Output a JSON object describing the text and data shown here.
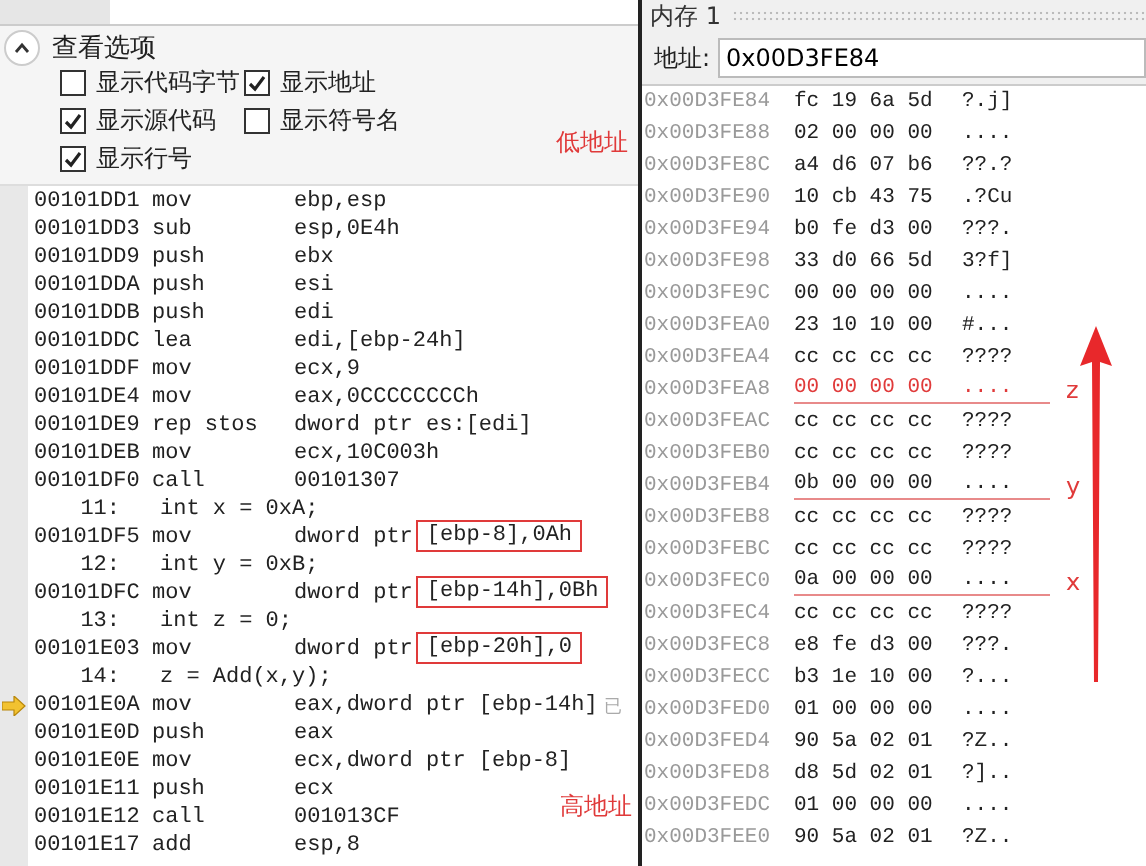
{
  "options": {
    "title": "查看选项",
    "expanded": true,
    "items": [
      {
        "label": "显示代码字节",
        "checked": false
      },
      {
        "label": "显示地址",
        "checked": true
      },
      {
        "label": "显示源代码",
        "checked": true
      },
      {
        "label": "显示符号名",
        "checked": false
      },
      {
        "label": "显示行号",
        "checked": true
      }
    ]
  },
  "disassembly": {
    "hint": "已",
    "lines": [
      {
        "kind": "asm",
        "address": "00101DD1",
        "mnemonic": "mov",
        "operands": "ebp,esp",
        "current": false
      },
      {
        "kind": "asm",
        "address": "00101DD3",
        "mnemonic": "sub",
        "operands": "esp,0E4h",
        "current": false
      },
      {
        "kind": "asm",
        "address": "00101DD9",
        "mnemonic": "push",
        "operands": "ebx",
        "current": false
      },
      {
        "kind": "asm",
        "address": "00101DDA",
        "mnemonic": "push",
        "operands": "esi",
        "current": false
      },
      {
        "kind": "asm",
        "address": "00101DDB",
        "mnemonic": "push",
        "operands": "edi",
        "current": false
      },
      {
        "kind": "asm",
        "address": "00101DDC",
        "mnemonic": "lea",
        "operands": "edi,[ebp-24h]",
        "current": false
      },
      {
        "kind": "asm",
        "address": "00101DDF",
        "mnemonic": "mov",
        "operands": "ecx,9",
        "current": false
      },
      {
        "kind": "asm",
        "address": "00101DE4",
        "mnemonic": "mov",
        "operands": "eax,0CCCCCCCCh",
        "current": false
      },
      {
        "kind": "asm",
        "address": "00101DE9",
        "mnemonic": "rep stos",
        "operands": "dword ptr es:[edi]",
        "current": false
      },
      {
        "kind": "asm",
        "address": "00101DEB",
        "mnemonic": "mov",
        "operands": "ecx,10C003h",
        "current": false
      },
      {
        "kind": "asm",
        "address": "00101DF0",
        "mnemonic": "call",
        "operands": "00101307",
        "current": false
      },
      {
        "kind": "source",
        "line_no": "11:",
        "code": "int x = 0xA;"
      },
      {
        "kind": "asm",
        "address": "00101DF5",
        "mnemonic": "mov",
        "operands": "dword ptr",
        "highlight": "[ebp-8],0Ah",
        "current": false
      },
      {
        "kind": "source",
        "line_no": "12:",
        "code": "int y = 0xB;"
      },
      {
        "kind": "asm",
        "address": "00101DFC",
        "mnemonic": "mov",
        "operands": "dword ptr",
        "highlight": "[ebp-14h],0Bh",
        "current": false
      },
      {
        "kind": "source",
        "line_no": "13:",
        "code": "int z = 0;"
      },
      {
        "kind": "asm",
        "address": "00101E03",
        "mnemonic": "mov",
        "operands": "dword ptr",
        "highlight": "[ebp-20h],0",
        "current": false
      },
      {
        "kind": "source",
        "line_no": "14:",
        "code": "z = Add(x,y);"
      },
      {
        "kind": "asm",
        "address": "00101E0A",
        "mnemonic": "mov",
        "operands": "eax,dword ptr [ebp-14h]",
        "current": true
      },
      {
        "kind": "asm",
        "address": "00101E0D",
        "mnemonic": "push",
        "operands": "eax",
        "current": false
      },
      {
        "kind": "asm",
        "address": "00101E0E",
        "mnemonic": "mov",
        "operands": "ecx,dword ptr [ebp-8]",
        "current": false
      },
      {
        "kind": "asm",
        "address": "00101E11",
        "mnemonic": "push",
        "operands": "ecx",
        "current": false
      },
      {
        "kind": "asm",
        "address": "00101E12",
        "mnemonic": "call",
        "operands": "001013CF",
        "current": false
      },
      {
        "kind": "asm",
        "address": "00101E17",
        "mnemonic": "add",
        "operands": "esp,8",
        "current": false
      }
    ]
  },
  "memory": {
    "title": "内存 1",
    "address_label": "地址:",
    "address": "0x00D3FE84",
    "rows": [
      {
        "address": "0x00D3FE84",
        "bytes": [
          "fc",
          "19",
          "6a",
          "5d"
        ],
        "chars": "?.j]",
        "changed": false
      },
      {
        "address": "0x00D3FE88",
        "bytes": [
          "02",
          "00",
          "00",
          "00"
        ],
        "chars": "....",
        "changed": false
      },
      {
        "address": "0x00D3FE8C",
        "bytes": [
          "a4",
          "d6",
          "07",
          "b6"
        ],
        "chars": "??.?",
        "changed": false
      },
      {
        "address": "0x00D3FE90",
        "bytes": [
          "10",
          "cb",
          "43",
          "75"
        ],
        "chars": ".?Cu",
        "changed": false
      },
      {
        "address": "0x00D3FE94",
        "bytes": [
          "b0",
          "fe",
          "d3",
          "00"
        ],
        "chars": "???.",
        "changed": false
      },
      {
        "address": "0x00D3FE98",
        "bytes": [
          "33",
          "d0",
          "66",
          "5d"
        ],
        "chars": "3?f]",
        "changed": false
      },
      {
        "address": "0x00D3FE9C",
        "bytes": [
          "00",
          "00",
          "00",
          "00"
        ],
        "chars": "....",
        "changed": false
      },
      {
        "address": "0x00D3FEA0",
        "bytes": [
          "23",
          "10",
          "10",
          "00"
        ],
        "chars": "#...",
        "changed": false
      },
      {
        "address": "0x00D3FEA4",
        "bytes": [
          "cc",
          "cc",
          "cc",
          "cc"
        ],
        "chars": "????",
        "changed": false
      },
      {
        "address": "0x00D3FEA8",
        "bytes": [
          "00",
          "00",
          "00",
          "00"
        ],
        "chars": "....",
        "changed": true,
        "note": "z"
      },
      {
        "address": "0x00D3FEAC",
        "bytes": [
          "cc",
          "cc",
          "cc",
          "cc"
        ],
        "chars": "????",
        "changed": false
      },
      {
        "address": "0x00D3FEB0",
        "bytes": [
          "cc",
          "cc",
          "cc",
          "cc"
        ],
        "chars": "????",
        "changed": false
      },
      {
        "address": "0x00D3FEB4",
        "bytes": [
          "0b",
          "00",
          "00",
          "00"
        ],
        "chars": "....",
        "changed": false,
        "note": "y"
      },
      {
        "address": "0x00D3FEB8",
        "bytes": [
          "cc",
          "cc",
          "cc",
          "cc"
        ],
        "chars": "????",
        "changed": false
      },
      {
        "address": "0x00D3FEBC",
        "bytes": [
          "cc",
          "cc",
          "cc",
          "cc"
        ],
        "chars": "????",
        "changed": false
      },
      {
        "address": "0x00D3FEC0",
        "bytes": [
          "0a",
          "00",
          "00",
          "00"
        ],
        "chars": "....",
        "changed": false,
        "note": "x"
      },
      {
        "address": "0x00D3FEC4",
        "bytes": [
          "cc",
          "cc",
          "cc",
          "cc"
        ],
        "chars": "????",
        "changed": false
      },
      {
        "address": "0x00D3FEC8",
        "bytes": [
          "e8",
          "fe",
          "d3",
          "00"
        ],
        "chars": "???.",
        "changed": false
      },
      {
        "address": "0x00D3FECC",
        "bytes": [
          "b3",
          "1e",
          "10",
          "00"
        ],
        "chars": "?...",
        "changed": false
      },
      {
        "address": "0x00D3FED0",
        "bytes": [
          "01",
          "00",
          "00",
          "00"
        ],
        "chars": "....",
        "changed": false
      },
      {
        "address": "0x00D3FED4",
        "bytes": [
          "90",
          "5a",
          "02",
          "01"
        ],
        "chars": "?Z..",
        "changed": false
      },
      {
        "address": "0x00D3FED8",
        "bytes": [
          "d8",
          "5d",
          "02",
          "01"
        ],
        "chars": "?]..",
        "changed": false
      },
      {
        "address": "0x00D3FEDC",
        "bytes": [
          "01",
          "00",
          "00",
          "00"
        ],
        "chars": "....",
        "changed": false
      },
      {
        "address": "0x00D3FEE0",
        "bytes": [
          "90",
          "5a",
          "02",
          "01"
        ],
        "chars": "?Z..",
        "changed": false
      }
    ]
  },
  "annotations": {
    "low": "低地址",
    "high": "高地址"
  }
}
